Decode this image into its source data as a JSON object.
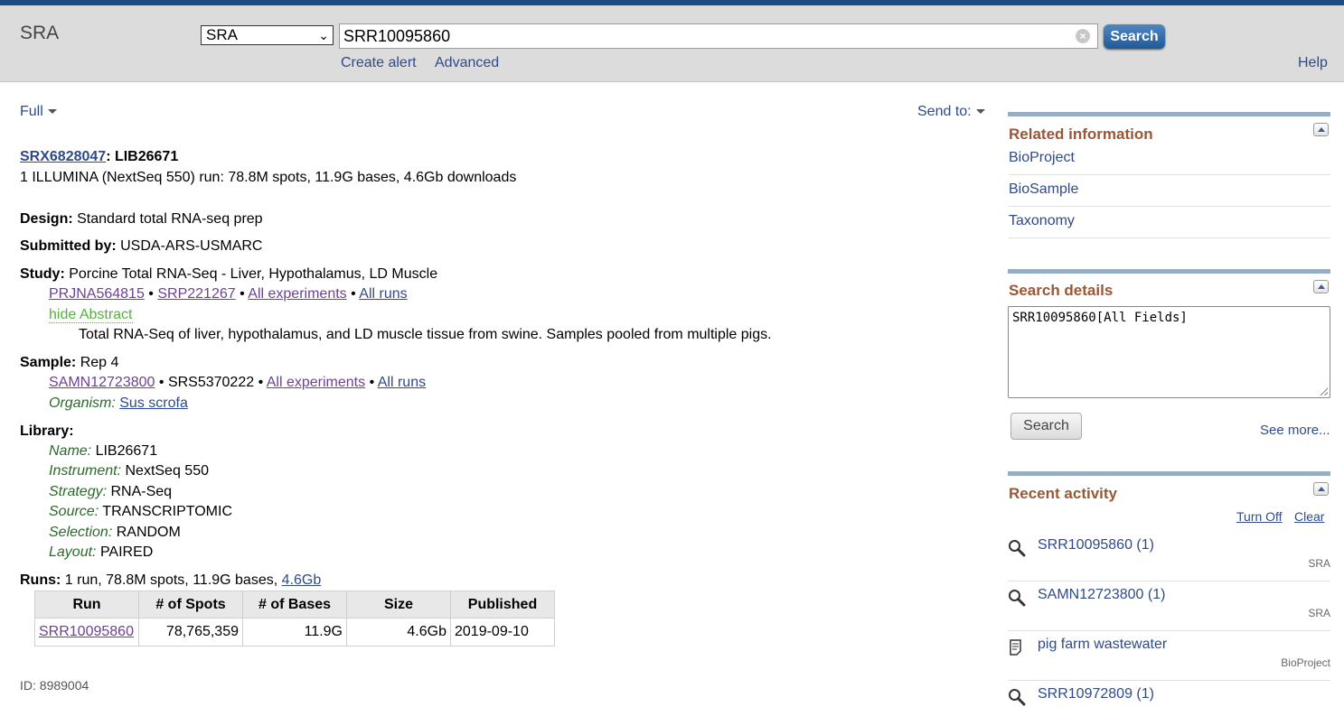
{
  "header": {
    "db_name": "SRA",
    "db_select": "SRA",
    "query": "SRR10095860",
    "search_label": "Search",
    "create_alert": "Create alert",
    "advanced": "Advanced",
    "help": "Help"
  },
  "toolbar": {
    "format": "Full",
    "send_to": "Send to:"
  },
  "record": {
    "accession": "SRX6828047",
    "title_suffix": ": LIB26671",
    "summary": "1 ILLUMINA (NextSeq 550) run: 78.8M spots, 11.9G bases, 4.6Gb downloads",
    "design_label": "Design:",
    "design": "Standard total RNA-seq prep",
    "submitted_label": "Submitted by:",
    "submitted": "USDA-ARS-USMARC",
    "study_label": "Study:",
    "study": "Porcine Total RNA-Seq - Liver, Hypothalamus, LD Muscle",
    "study_links": {
      "bioproject": "PRJNA564815",
      "srp": "SRP221267",
      "all_experiments": "All experiments",
      "all_runs": "All runs",
      "sep": "•"
    },
    "hide_abstract": "hide Abstract",
    "abstract": "Total RNA-Seq of liver, hypothalamus, and LD muscle tissue from swine. Samples pooled from multiple pigs.",
    "sample_label": "Sample:",
    "sample": "Rep 4",
    "sample_links": {
      "biosample": "SAMN12723800",
      "srs": "SRS5370222",
      "all_experiments": "All experiments",
      "all_runs": "All runs"
    },
    "organism_label": "Organism:",
    "organism": "Sus scrofa",
    "library_label": "Library:",
    "library": [
      {
        "k": "Name:",
        "v": "LIB26671"
      },
      {
        "k": "Instrument:",
        "v": "NextSeq 550"
      },
      {
        "k": "Strategy:",
        "v": "RNA-Seq"
      },
      {
        "k": "Source:",
        "v": "TRANSCRIPTOMIC"
      },
      {
        "k": "Selection:",
        "v": "RANDOM"
      },
      {
        "k": "Layout:",
        "v": "PAIRED"
      }
    ],
    "runs_label": "Runs:",
    "runs_summary": "1 run, 78.8M spots, 11.9G bases,",
    "runs_size_link": "4.6Gb",
    "runs_table": {
      "headers": [
        "Run",
        "# of Spots",
        "# of Bases",
        "Size",
        "Published"
      ],
      "rows": [
        [
          "SRR10095860",
          "78,765,359",
          "11.9G",
          "4.6Gb",
          "2019-09-10"
        ]
      ]
    },
    "id": "ID: 8989004"
  },
  "sidebar": {
    "related_title": "Related information",
    "related": [
      "BioProject",
      "BioSample",
      "Taxonomy"
    ],
    "details_title": "Search details",
    "details_query": "SRR10095860[All Fields]",
    "details_search": "Search",
    "see_more": "See more...",
    "recent_title": "Recent activity",
    "turn_off": "Turn Off",
    "clear": "Clear",
    "recent": [
      {
        "icon": "magnifier-icon",
        "text": "SRR10095860 (1)",
        "db": "SRA"
      },
      {
        "icon": "magnifier-icon",
        "text": "SAMN12723800 (1)",
        "db": "SRA"
      },
      {
        "icon": "document-icon",
        "text": "pig farm wastewater",
        "db": "BioProject"
      },
      {
        "icon": "magnifier-icon",
        "text": "SRR10972809 (1)",
        "db": ""
      }
    ]
  }
}
